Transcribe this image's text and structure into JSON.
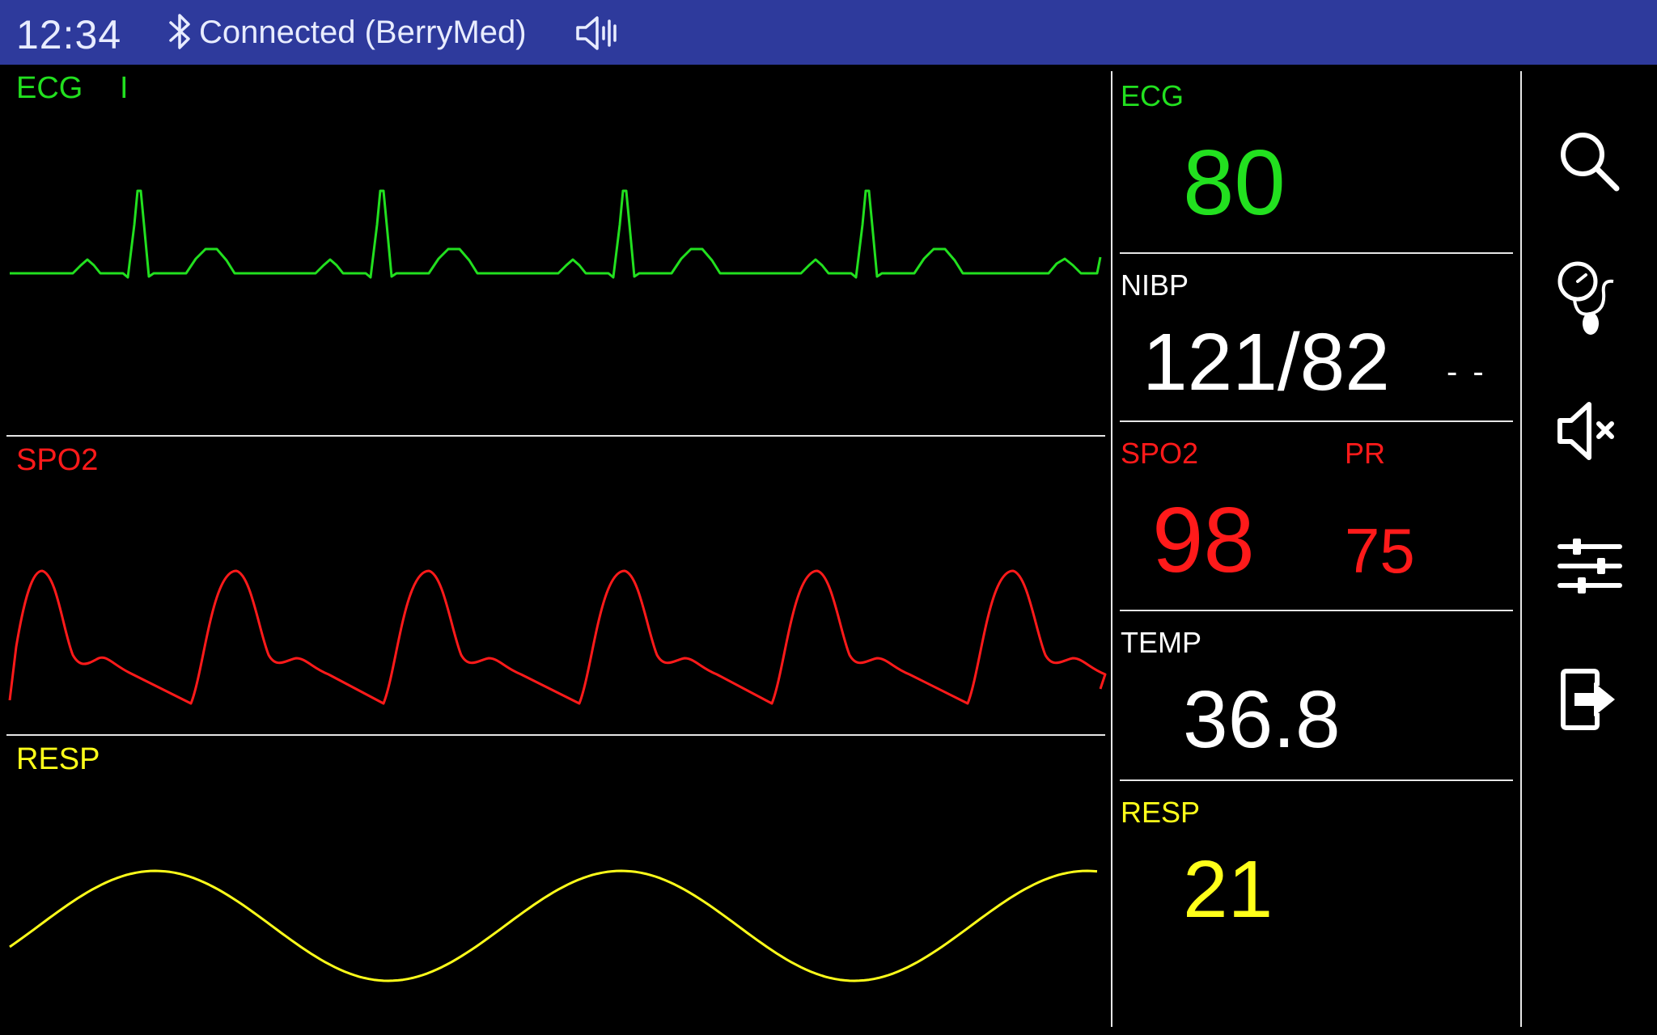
{
  "status_bar": {
    "time": "12:34",
    "connection": "Connected (BerryMed)",
    "bluetooth_icon": "bluetooth-icon",
    "sound_icon": "speaker-on-icon",
    "background": "#2e3a9c"
  },
  "waveforms": {
    "ecg": {
      "label": "ECG",
      "lead": "I",
      "color": "#22e01f"
    },
    "spo2": {
      "label": "SPO2",
      "color": "#ff1a1a"
    },
    "resp": {
      "label": "RESP",
      "color": "#ffff1a"
    }
  },
  "params": {
    "ecg": {
      "label": "ECG",
      "value": "80",
      "color": "#22e01f"
    },
    "nibp": {
      "label": "NIBP",
      "value": "121/82",
      "extra": "- -",
      "color": "#ffffff"
    },
    "spo2": {
      "label": "SPO2",
      "value": "98",
      "color": "#ff1a1a"
    },
    "pr": {
      "label": "PR",
      "value": "75",
      "color": "#ff1a1a"
    },
    "temp": {
      "label": "TEMP",
      "value": "36.8",
      "color": "#ffffff"
    },
    "resp": {
      "label": "RESP",
      "value": "21",
      "color": "#ffff1a"
    }
  },
  "toolbar": {
    "icons": [
      "search-icon",
      "blood-pressure-cuff-icon",
      "mute-icon",
      "settings-sliders-icon",
      "exit-icon"
    ]
  }
}
